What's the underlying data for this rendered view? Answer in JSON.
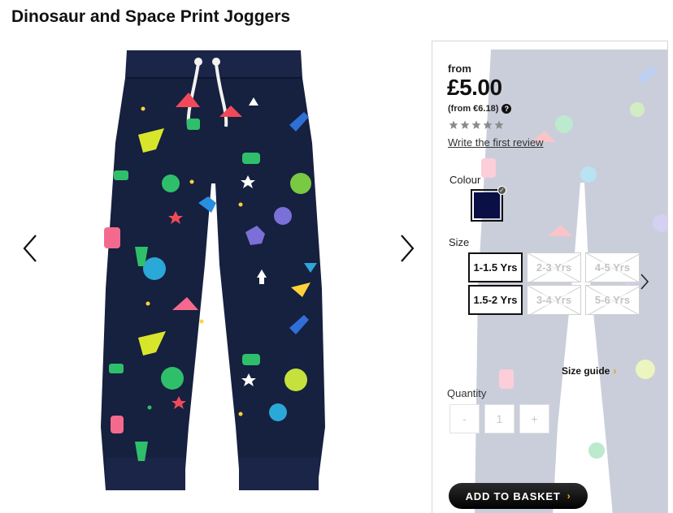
{
  "product": {
    "title": "Dinosaur and Space Print Joggers"
  },
  "gallery": {
    "prev_icon": "chevron-left-icon",
    "next_icon": "chevron-right-icon",
    "image": "navy-joggers-dinosaur-space-print"
  },
  "pricing": {
    "from_label": "from",
    "price": "£5.00",
    "alt_price": "(from €6.18)",
    "help_icon": "?"
  },
  "reviews": {
    "rating": 0,
    "max_rating": 5,
    "link_label": "Write the first review"
  },
  "colour": {
    "label": "Colour",
    "swatches": [
      {
        "color": "#0a0f45",
        "selected": true,
        "check": "✓"
      }
    ]
  },
  "size": {
    "label": "Size",
    "options": [
      {
        "label": "1-1.5 Yrs",
        "available": true
      },
      {
        "label": "2-3 Yrs",
        "available": false
      },
      {
        "label": "4-5 Yrs",
        "available": false
      },
      {
        "label": "1.5-2 Yrs",
        "available": true
      },
      {
        "label": "3-4 Yrs",
        "available": false
      },
      {
        "label": "5-6 Yrs",
        "available": false
      }
    ],
    "next_icon": "chevron-right-icon",
    "guide_label": "Size guide",
    "guide_chevron": "›"
  },
  "quantity": {
    "label": "Quantity",
    "minus": "-",
    "value": "1",
    "plus": "+"
  },
  "basket": {
    "label": "ADD TO BASKET",
    "chevron": "›"
  },
  "colors": {
    "navy": "#16203f",
    "accent_yellow": "#f2b400"
  }
}
